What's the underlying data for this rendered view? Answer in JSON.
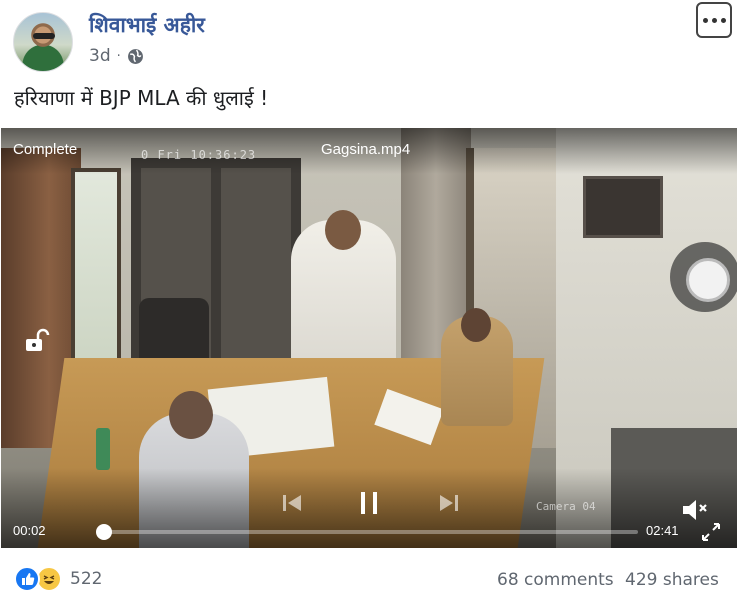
{
  "post": {
    "author": "शिवाभाई अहीर",
    "time": "3d",
    "separator": "·",
    "privacy_icon": "globe-icon",
    "text": "हरियाणा में BJP MLA की धुलाई !",
    "more_icon": "more-horizontal-icon"
  },
  "video": {
    "status": "Complete",
    "cctv_timestamp": "0 Fri 10:36:23",
    "filename": "Gagsina.mp4",
    "camera_label": "Camera 04",
    "current_time": "00:02",
    "duration": "02:41",
    "progress": 0.012,
    "icons": [
      "lock-open-icon",
      "record-icon",
      "previous-icon",
      "pause-icon",
      "next-icon",
      "volume-icon",
      "fullscreen-icon"
    ]
  },
  "footer": {
    "reaction_icons": [
      "like-icon",
      "haha-icon"
    ],
    "reaction_count": "522",
    "comments": "68 comments",
    "shares": "429 shares"
  },
  "colors": {
    "author": "#385898",
    "meta": "#606770",
    "like": "#1877f2",
    "haha": "#f7c744"
  }
}
